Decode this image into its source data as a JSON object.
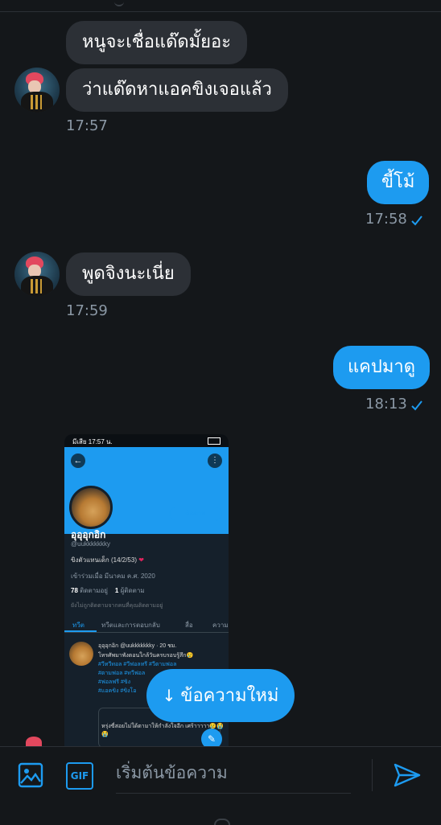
{
  "conversation": {
    "messages": [
      {
        "id": "m1",
        "dir": "in",
        "text": "หนูจะเชื่อแด๊ดมั้ยอะ"
      },
      {
        "id": "m2",
        "dir": "in",
        "text": "ว่าแด๊ดหาแอคขิงเจอแล้ว",
        "time": "17:57"
      },
      {
        "id": "m3",
        "dir": "out",
        "text": "ขี้โม้",
        "time": "17:58"
      },
      {
        "id": "m4",
        "dir": "in",
        "text": "พูดจิงนะเนี่ย",
        "time": "17:59"
      },
      {
        "id": "m5",
        "dir": "out",
        "text": "แคปมาดู",
        "time": "18:13"
      }
    ]
  },
  "attachment": {
    "status_time": "มีเสีย 17:57 น.",
    "back_icon": "back-arrow-icon",
    "more_icon": "more-icon",
    "follow_label": "ติดตาม",
    "name": "อุอุอุกอิก",
    "handle": "@uukkkkkkky",
    "bio": "ขิงตัวแทนเด็ก (14/2/53)",
    "bio_heart": "❤",
    "joined": "เข้าร่วมเมื่อ มีนาคม ค.ศ. 2020",
    "following_count": "78",
    "following_label": "ติดตามอยู่",
    "followers_count": "1",
    "followers_label": "ผู้ติดตาม",
    "not_followed_note": "ยังไม่ถูกติดตามจากคนที่คุณติดตามอยู่",
    "tabs": [
      "ทวีต",
      "ทวีตและการตอบกลับ",
      "สื่อ",
      "ความ"
    ],
    "tweet_header": "อุอุอุกอิก @uukkkkkkky · 20 ชม.",
    "tweet_lines": [
      "โทรศัพมาพังตอนใกล้วันครบรอบรู้สึก😢",
      "#วีทวีทอล #วีฟอลทรี #วีตามฟอล",
      "#ตามฟอล #ทวีฟอล",
      "#ฟอลฟรี #ขิง",
      "#แอคขิง #ขิงโอ"
    ],
    "card_text": "หรุ่งขี่สอยไม่ใด้ตามาให้กำลังใจอีก เศร้าาาาา😢😭😭"
  },
  "new_messages_button": {
    "arrow": "↓",
    "label": "ข้อความใหม่"
  },
  "composer": {
    "image_icon": "image-icon",
    "gif_label": "GIF",
    "placeholder": "เริ่มต้นข้อความ",
    "send_icon": "send-icon"
  },
  "colors": {
    "accent": "#1d9bf0",
    "incoming_bubble": "#2c3036",
    "background": "#14171a",
    "meta": "#8b98a5"
  }
}
